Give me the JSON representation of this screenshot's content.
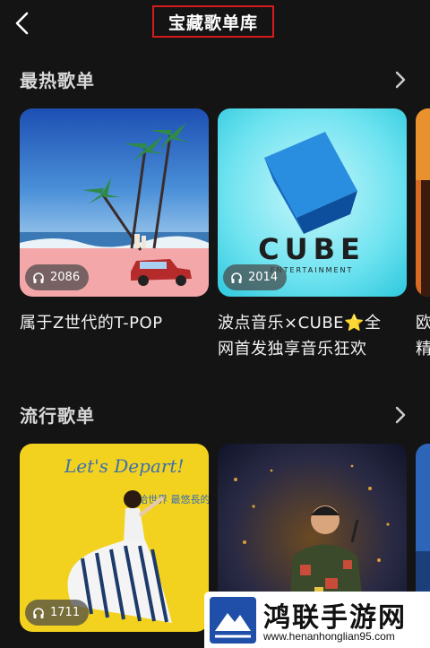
{
  "header": {
    "title": "宝藏歌单库"
  },
  "hot": {
    "title": "最热歌单",
    "items": [
      {
        "plays": "2086",
        "caption_line1": "属于Z世代的T-POP",
        "caption_line2": ""
      },
      {
        "plays": "2014",
        "caption_line1": "波点音乐×CUBE⭐全",
        "caption_line2": "网首发独享音乐狂欢",
        "cover_text": "CUBE",
        "cover_subtext": "ENTERTAINMENT"
      },
      {
        "caption_line1": "欧",
        "caption_line2": "精"
      }
    ]
  },
  "popular": {
    "title": "流行歌单",
    "items": [
      {
        "plays": "1711",
        "cover_text": "Let's Depart!",
        "cover_subtext": "給世界 最悠長的吻"
      },
      {}
    ]
  },
  "watermark": {
    "name": "鸿联手游网",
    "url": "www.henanhonglian95.com"
  },
  "colors": {
    "background": "#141414",
    "highlight_box": "#d51b1b"
  },
  "icons": {
    "back": "chevron-left-icon",
    "more": "chevron-right-icon",
    "plays": "headphones-icon"
  }
}
